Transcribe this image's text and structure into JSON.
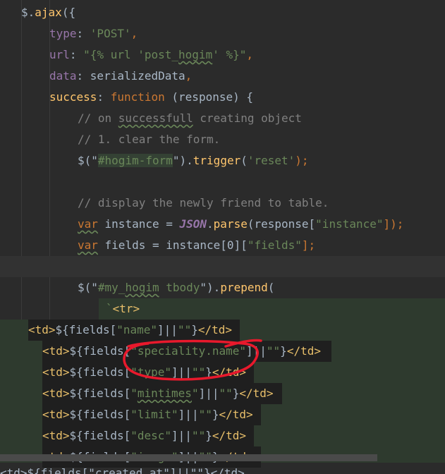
{
  "code": {
    "l1": {
      "obj": "$",
      "method": "ajax",
      "punct": "({"
    },
    "l2": {
      "key": "type",
      "value": "'POST'"
    },
    "l3": {
      "key": "url",
      "value_a": "\"{% url 'post_",
      "value_word": "hogim",
      "value_b": "' %}\""
    },
    "l4": {
      "key": "data",
      "value": "serializedData"
    },
    "l5": {
      "key": "success",
      "kw": "function",
      "args": "(response) {"
    },
    "l6": {
      "a": "// on ",
      "w1": "successfull",
      "b": " creating object"
    },
    "l7": {
      "text": "// 1. clear the form."
    },
    "l8": {
      "a": "$(\"",
      "sel": "#hogim-form",
      "b": "\").",
      "fn": "trigger",
      "c": "(",
      "arg": "'reset'",
      "d": ");"
    },
    "l10": {
      "text": "// display the newly friend to table."
    },
    "l11": {
      "kw": "var",
      "name": " instance = ",
      "obj": "JSON",
      "dot": ".",
      "fn": "parse",
      "a": "(response[",
      "str": "\"instance\"",
      "b": "]);"
    },
    "l12": {
      "kw": "var",
      "name": " fields = instance[0][",
      "str": "\"fields\"",
      "b": "];"
    },
    "l14": {
      "a": "$(\"",
      "sel_a": "#my_",
      "sel_word": "hogim",
      "sel_b": " tbody",
      "b": "\").",
      "fn": "prepend",
      "c": "("
    },
    "l15": {
      "a": "`",
      "tag": "<tr>"
    },
    "l16": {
      "open": "<td>",
      "expr_a": "${fields[",
      "str": "\"name\"",
      "expr_b": "]||",
      "empty": "\"\"",
      "expr_c": "}",
      "close": "</td>"
    },
    "l17": {
      "open": "<td>",
      "expr_a": "${fields[",
      "str": "\"speciality.name\"",
      "expr_b": "]||",
      "empty": "\"\"",
      "expr_c": "}",
      "close": "</td>"
    },
    "l18": {
      "open": "<td>",
      "expr_a": "${fields[",
      "str": "\"type\"",
      "expr_b": "]||",
      "empty": "\"\"",
      "expr_c": "}",
      "close": "</td>"
    },
    "l19": {
      "open": "<td>",
      "expr_a": "${fields[",
      "str_a": "\"",
      "str_word": "mintimes",
      "str_b": "\"",
      "expr_b": "]||",
      "empty": "\"\"",
      "expr_c": "}",
      "close": "</td>"
    },
    "l20": {
      "open": "<td>",
      "expr_a": "${fields[",
      "str": "\"limit\"",
      "expr_b": "]||",
      "empty": "\"\"",
      "expr_c": "}",
      "close": "</td>"
    },
    "l21": {
      "open": "<td>",
      "expr_a": "${fields[",
      "str": "\"desc\"",
      "expr_b": "]||",
      "empty": "\"\"",
      "expr_c": "}",
      "close": "</td>"
    },
    "l22": {
      "open": "<td>",
      "expr_a": "${fields[",
      "str": "\"image\"",
      "expr_b": "]||",
      "empty": "\"\"",
      "expr_c": "}",
      "close": "</td>"
    },
    "bottom": "<td>${fields[\"created_at\"]||\"\"}</td>"
  },
  "colors": {
    "background": "#2b2b2b",
    "keyword": "#cc7832",
    "string": "#6a8759",
    "function": "#ffc66d",
    "property": "#9876aa",
    "comment": "#808080",
    "annotation": "#e8192c"
  }
}
